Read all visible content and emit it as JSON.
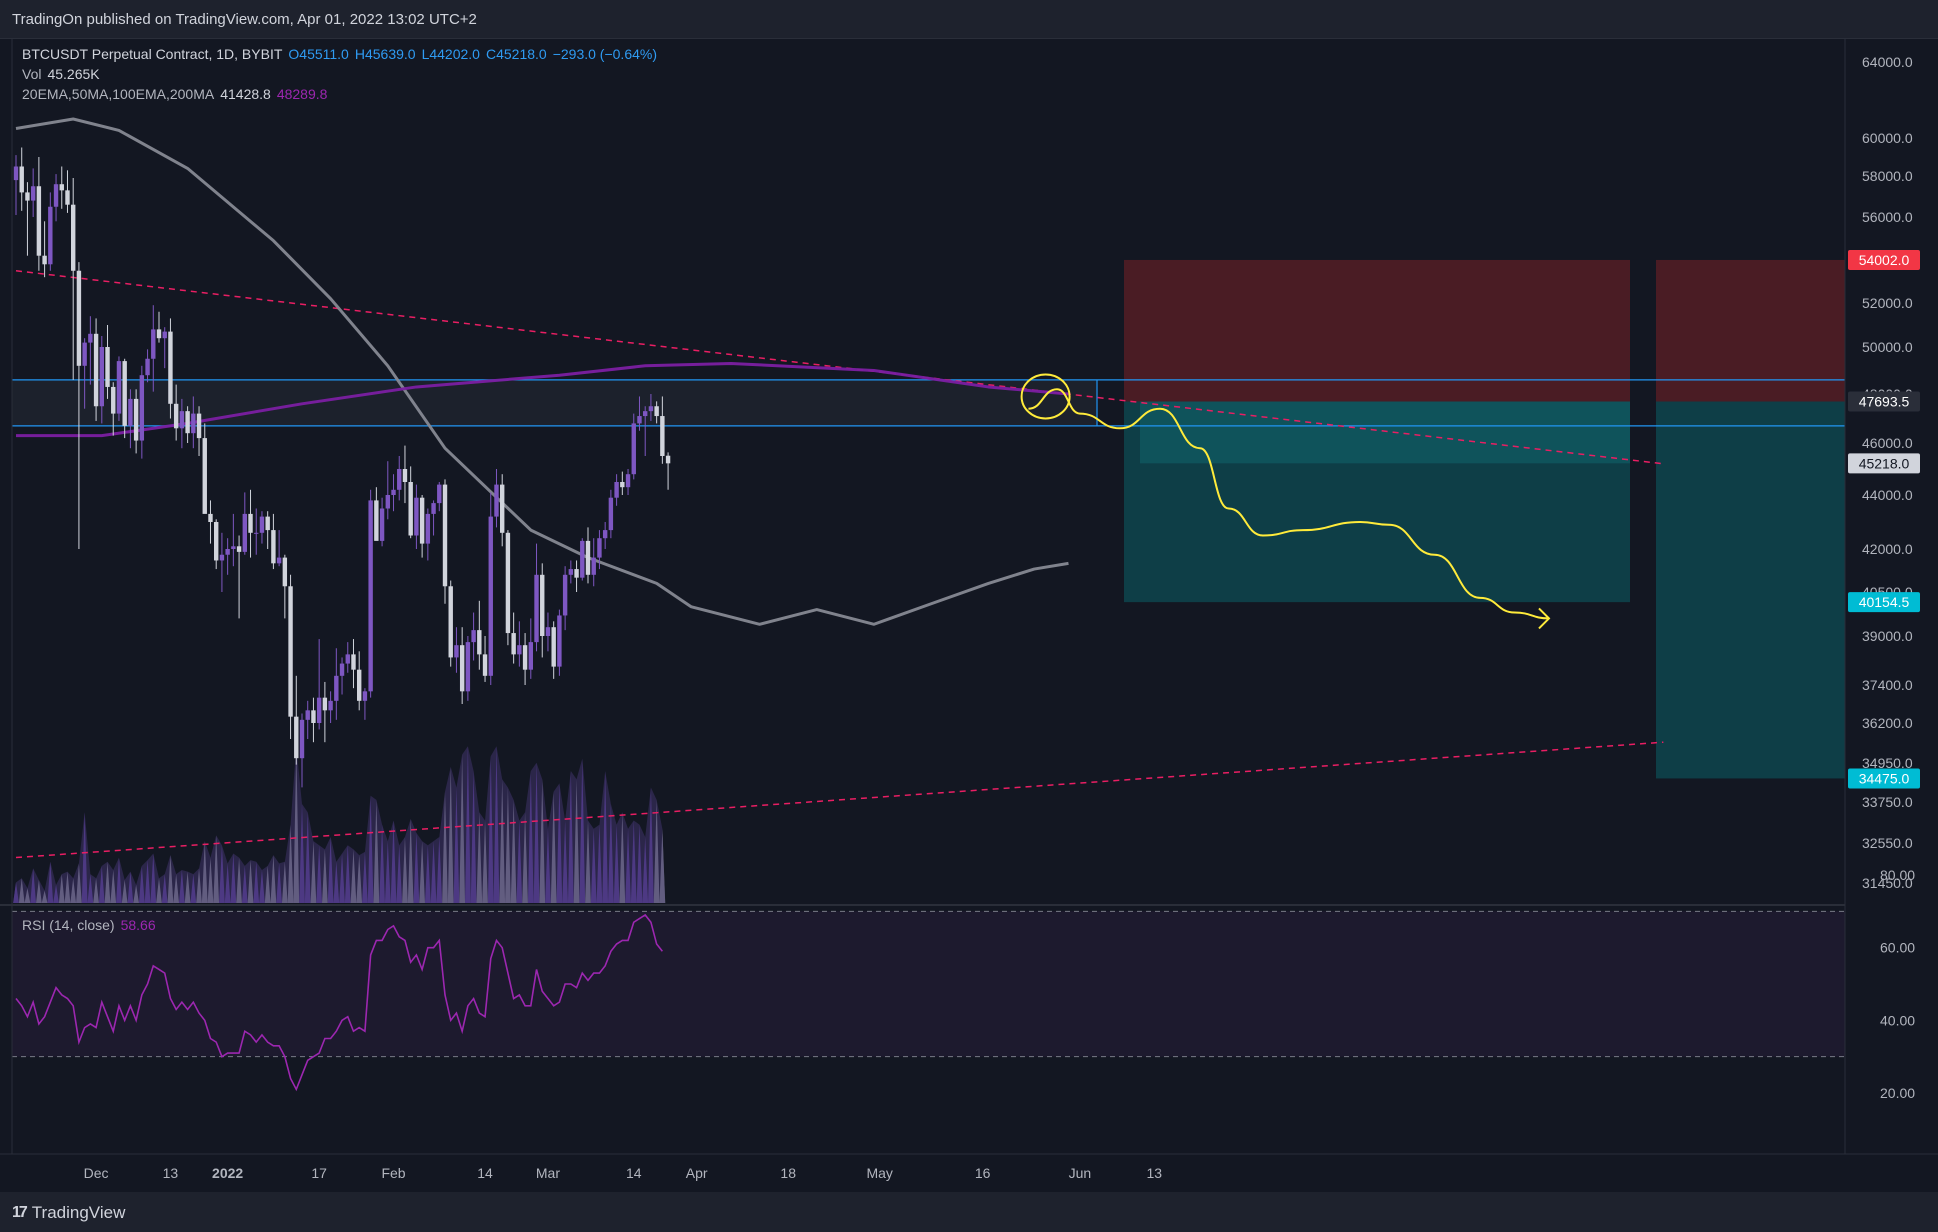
{
  "header": {
    "publisher_text": "TradingOn published on TradingView.com, Apr 01, 2022 13:02 UTC+2"
  },
  "footer": {
    "brand": "TradingView",
    "logo_glyph": "17"
  },
  "legend": {
    "symbol": "BTCUSDT Perpetual Contract, 1D, BYBIT",
    "open": "O45511.0",
    "high": "H45639.0",
    "low": "L44202.0",
    "close": "C45218.0",
    "change": "−293.0 (−0.64%)",
    "vol_label": "Vol",
    "vol_value": "45.265K",
    "ma_label": "20EMA,50MA,100EMA,200MA",
    "ma_value_1": "41428.8",
    "ma_value_2": "48289.8"
  },
  "rsi": {
    "label": "RSI (14, close)",
    "value": "58.66"
  },
  "colors": {
    "background": "#131722",
    "candle_up": "#7e57c2",
    "candle_down": "#d1d4dc",
    "ma_gray": "#868993",
    "ma_purple": "#7b1fa2",
    "trendline": "#e91e63",
    "horizontal_lines": "#2196f3",
    "projection": "#ffeb3b",
    "stop_zone": "#5d1f26",
    "target_zone": "#0e4851",
    "rsi_line": "#9c27b0"
  },
  "chart_data": {
    "type": "candlestick",
    "symbol": "BTCUSDT",
    "timeframe": "1D",
    "price_axis": {
      "ticks": [
        "64000.0",
        "60000.0",
        "58000.0",
        "56000.0",
        "52000.0",
        "50000.0",
        "48000.0",
        "46000.0",
        "44000.0",
        "42000.0",
        "40500.0",
        "39000.0",
        "37400.0",
        "36200.0",
        "34950.0",
        "33750.0",
        "32550.0",
        "31450.0"
      ],
      "labels": [
        {
          "text": "54002.0",
          "value": 54002,
          "color": "#f23645"
        },
        {
          "text": "47693.5",
          "value": 47693.5,
          "color": "#2a2e39"
        },
        {
          "text": "45218.0",
          "value": 45218,
          "color": "#d1d4dc"
        },
        {
          "text": "40154.5",
          "value": 40154.5,
          "color": "#00bcd4"
        },
        {
          "text": "34475.0",
          "value": 34475,
          "color": "#00bcd4"
        }
      ]
    },
    "time_axis": {
      "ticks": [
        "Dec",
        "13",
        "2022",
        "17",
        "Feb",
        "14",
        "Mar",
        "14",
        "Apr",
        "18",
        "May",
        "16",
        "Jun",
        "13"
      ]
    },
    "rsi_axis": {
      "ticks": [
        "80.00",
        "60.00",
        "40.00",
        "20.00"
      ],
      "overbought": 70,
      "oversold": 30
    },
    "candles": [
      [
        57800,
        59100,
        56100,
        58500
      ],
      [
        58500,
        59500,
        56300,
        57200
      ],
      [
        57200,
        57700,
        54200,
        56800
      ],
      [
        56800,
        58400,
        56000,
        57500
      ],
      [
        57500,
        59000,
        53500,
        54200
      ],
      [
        54200,
        55800,
        53200,
        53800
      ],
      [
        53800,
        57200,
        53500,
        56500
      ],
      [
        56500,
        58100,
        55800,
        57600
      ],
      [
        57600,
        58500,
        56400,
        57300
      ],
      [
        57300,
        58300,
        56200,
        56600
      ],
      [
        56600,
        57900,
        48600,
        53500
      ],
      [
        53500,
        53900,
        42000,
        49200
      ],
      [
        49200,
        50400,
        47400,
        50200
      ],
      [
        50200,
        51400,
        48400,
        50600
      ],
      [
        50600,
        51300,
        46900,
        47500
      ],
      [
        47500,
        50500,
        46800,
        50000
      ],
      [
        50000,
        51000,
        47800,
        48300
      ],
      [
        48300,
        48500,
        46300,
        47200
      ],
      [
        47200,
        49600,
        46900,
        49400
      ],
      [
        49400,
        49500,
        46200,
        46700
      ],
      [
        46700,
        48200,
        45800,
        47800
      ],
      [
        47800,
        48200,
        45600,
        46100
      ],
      [
        46100,
        49200,
        45400,
        48800
      ],
      [
        48800,
        49900,
        48500,
        49500
      ],
      [
        49500,
        51900,
        48100,
        50800
      ],
      [
        50800,
        51600,
        50200,
        50400
      ],
      [
        50400,
        50900,
        49100,
        50700
      ],
      [
        50700,
        51300,
        47000,
        47600
      ],
      [
        47600,
        48400,
        46100,
        46600
      ],
      [
        46600,
        47800,
        45800,
        47300
      ],
      [
        47300,
        47500,
        46000,
        46400
      ],
      [
        46400,
        47900,
        45800,
        47200
      ],
      [
        47200,
        47500,
        45500,
        46200
      ],
      [
        46200,
        46800,
        43800,
        43300
      ],
      [
        43300,
        43800,
        42200,
        43000
      ],
      [
        43000,
        43100,
        41300,
        41600
      ],
      [
        41600,
        42600,
        40500,
        41800
      ],
      [
        41800,
        42400,
        41100,
        42000
      ],
      [
        42000,
        43300,
        41400,
        42100
      ],
      [
        42100,
        42500,
        39600,
        41900
      ],
      [
        41900,
        44100,
        41800,
        43300
      ],
      [
        43300,
        44200,
        41700,
        42600
      ],
      [
        42600,
        43500,
        41800,
        42600
      ],
      [
        42600,
        43400,
        42200,
        43200
      ],
      [
        43200,
        43400,
        42000,
        42700
      ],
      [
        42700,
        43300,
        41300,
        41500
      ],
      [
        41500,
        42700,
        41400,
        41700
      ],
      [
        41700,
        41800,
        39600,
        40700
      ],
      [
        40700,
        41100,
        35700,
        36400
      ],
      [
        36400,
        37700,
        34900,
        35100
      ],
      [
        35100,
        36500,
        34200,
        36300
      ],
      [
        36300,
        36900,
        35700,
        36600
      ],
      [
        36600,
        37000,
        35600,
        36200
      ],
      [
        36200,
        38900,
        36000,
        37000
      ],
      [
        37000,
        37500,
        35600,
        36600
      ],
      [
        36600,
        37200,
        36200,
        36900
      ],
      [
        36900,
        38600,
        36300,
        37700
      ],
      [
        37700,
        38300,
        37100,
        38100
      ],
      [
        38100,
        38800,
        37800,
        38400
      ],
      [
        38400,
        38900,
        37300,
        37900
      ],
      [
        37900,
        38500,
        36600,
        36900
      ],
      [
        36900,
        37300,
        36300,
        37200
      ],
      [
        37200,
        44200,
        37000,
        43800
      ],
      [
        43800,
        44300,
        42700,
        42300
      ],
      [
        42300,
        43900,
        42100,
        43500
      ],
      [
        43500,
        45300,
        43100,
        44000
      ],
      [
        44000,
        44800,
        43400,
        44200
      ],
      [
        44200,
        45500,
        43800,
        45000
      ],
      [
        45000,
        45900,
        43700,
        44500
      ],
      [
        44500,
        45100,
        42400,
        42500
      ],
      [
        42500,
        44400,
        42000,
        43900
      ],
      [
        43900,
        44000,
        41700,
        42200
      ],
      [
        42200,
        43500,
        41600,
        43300
      ],
      [
        43300,
        43800,
        42500,
        43700
      ],
      [
        43700,
        44500,
        43400,
        44400
      ],
      [
        44400,
        44600,
        40100,
        40700
      ],
      [
        40700,
        40900,
        38000,
        38300
      ],
      [
        38300,
        39300,
        37800,
        38700
      ],
      [
        38700,
        39300,
        36800,
        37200
      ],
      [
        37200,
        39000,
        36900,
        38800
      ],
      [
        38800,
        39800,
        38200,
        39200
      ],
      [
        39200,
        40200,
        37900,
        38400
      ],
      [
        38400,
        39000,
        37500,
        37700
      ],
      [
        37700,
        44100,
        37400,
        43200
      ],
      [
        43200,
        45000,
        42800,
        44400
      ],
      [
        44400,
        44800,
        42100,
        42600
      ],
      [
        42600,
        42700,
        38700,
        39100
      ],
      [
        39100,
        39800,
        38100,
        38400
      ],
      [
        38400,
        39500,
        38000,
        38700
      ],
      [
        38700,
        39100,
        37400,
        37900
      ],
      [
        37900,
        39600,
        37600,
        38800
      ],
      [
        38800,
        42200,
        38500,
        41100
      ],
      [
        41100,
        41500,
        38300,
        39000
      ],
      [
        39000,
        39800,
        38500,
        39300
      ],
      [
        39300,
        39500,
        37600,
        38000
      ],
      [
        38000,
        39900,
        37700,
        39700
      ],
      [
        39700,
        41400,
        39200,
        41100
      ],
      [
        41100,
        41600,
        40800,
        41300
      ],
      [
        41300,
        41600,
        40500,
        41000
      ],
      [
        41000,
        42400,
        40900,
        42300
      ],
      [
        42300,
        42800,
        40800,
        41100
      ],
      [
        41100,
        42400,
        40700,
        41700
      ],
      [
        41700,
        42700,
        41300,
        42400
      ],
      [
        42400,
        43000,
        42000,
        42700
      ],
      [
        42700,
        44200,
        42400,
        43900
      ],
      [
        43900,
        44800,
        43600,
        44500
      ],
      [
        44500,
        44900,
        44000,
        44300
      ],
      [
        44300,
        45000,
        44000,
        44800
      ],
      [
        44800,
        47200,
        44600,
        46800
      ],
      [
        46800,
        47900,
        46500,
        47100
      ],
      [
        47100,
        47500,
        45500,
        47300
      ],
      [
        47300,
        48000,
        46900,
        47500
      ],
      [
        47500,
        47700,
        46800,
        47100
      ],
      [
        47100,
        47900,
        45200,
        45500
      ],
      [
        45511,
        45639,
        44202,
        45218
      ]
    ],
    "rsi_values": [
      46,
      44,
      41,
      45,
      39,
      41,
      45,
      49,
      47,
      46,
      44,
      34,
      38,
      39,
      38,
      45,
      41,
      37,
      44,
      40,
      44,
      40,
      47,
      50,
      55,
      54,
      53,
      46,
      43,
      45,
      43,
      45,
      42,
      40,
      35,
      34,
      30,
      31,
      31,
      31,
      37,
      36,
      34,
      36,
      34,
      33,
      33,
      30,
      24,
      21,
      25,
      29,
      30,
      31,
      35,
      35,
      37,
      40,
      41,
      37,
      38,
      37,
      58,
      62,
      62,
      65,
      66,
      63,
      62,
      56,
      58,
      54,
      60,
      60,
      62,
      47,
      40,
      42,
      37,
      44,
      46,
      42,
      41,
      57,
      62,
      60,
      53,
      46,
      47,
      44,
      44,
      54,
      48,
      46,
      44,
      45,
      50,
      50,
      49,
      53,
      51,
      53,
      53,
      55,
      59,
      61,
      62,
      62,
      67,
      68,
      69,
      67,
      61,
      59
    ],
    "volume_values": [
      25,
      30,
      18,
      42,
      28,
      15,
      50,
      22,
      35,
      38,
      30,
      48,
      110,
      35,
      30,
      45,
      50,
      40,
      55,
      28,
      38,
      22,
      45,
      52,
      60,
      30,
      35,
      58,
      35,
      40,
      38,
      35,
      42,
      75,
      55,
      82,
      70,
      48,
      60,
      55,
      45,
      52,
      50,
      40,
      45,
      58,
      48,
      50,
      95,
      190,
      120,
      110,
      75,
      70,
      65,
      80,
      50,
      60,
      70,
      65,
      58,
      62,
      130,
      125,
      95,
      75,
      100,
      70,
      80,
      102,
      85,
      75,
      70,
      75,
      80,
      135,
      165,
      140,
      180,
      190,
      160,
      110,
      100,
      178,
      190,
      150,
      140,
      125,
      100,
      110,
      160,
      170,
      150,
      90,
      135,
      145,
      100,
      160,
      150,
      175,
      100,
      90,
      95,
      160,
      120,
      95,
      110,
      90,
      100,
      95,
      80,
      140,
      125,
      90
    ],
    "moving_averages": [
      {
        "name": "50MA",
        "color": "#868993",
        "points": [
          [
            0,
            60500
          ],
          [
            10,
            61000
          ],
          [
            18,
            60400
          ],
          [
            30,
            58400
          ],
          [
            45,
            54900
          ],
          [
            55,
            52200
          ],
          [
            65,
            49200
          ],
          [
            75,
            45800
          ],
          [
            90,
            42700
          ],
          [
            100,
            41700
          ],
          [
            112,
            40800
          ],
          [
            118,
            40000
          ],
          [
            130,
            39400
          ],
          [
            140,
            39900
          ],
          [
            150,
            39400
          ],
          [
            160,
            40100
          ],
          [
            170,
            40800
          ],
          [
            178,
            41300
          ],
          [
            184,
            41500
          ]
        ]
      },
      {
        "name": "200MA",
        "color": "#7b1fa2",
        "points": [
          [
            0,
            46300
          ],
          [
            15,
            46300
          ],
          [
            30,
            46800
          ],
          [
            50,
            47600
          ],
          [
            70,
            48300
          ],
          [
            95,
            48800
          ],
          [
            110,
            49200
          ],
          [
            125,
            49300
          ],
          [
            150,
            49000
          ],
          [
            170,
            48300
          ],
          [
            184,
            48000
          ]
        ]
      }
    ],
    "drawings": {
      "horizontal_lines": [
        48600,
        46700
      ],
      "upper_trendline": [
        [
          0,
          53500
        ],
        [
          288,
          45200
        ]
      ],
      "lower_trendline": [
        [
          0,
          32150
        ],
        [
          288,
          35600
        ]
      ],
      "short_position_1": {
        "entry": 47693.5,
        "stop": 54002,
        "target": 40154.5
      },
      "short_position_2": {
        "entry": 47693.5,
        "stop": 54002,
        "target": 34475
      },
      "projection_points": [
        [
          177,
          47400
        ],
        [
          182,
          48200
        ],
        [
          186,
          47200
        ],
        [
          193,
          46600
        ],
        [
          200,
          47400
        ],
        [
          207,
          45800
        ],
        [
          212,
          43500
        ],
        [
          218,
          42500
        ],
        [
          225,
          42700
        ],
        [
          235,
          43000
        ],
        [
          240,
          42900
        ],
        [
          248,
          41800
        ],
        [
          256,
          40300
        ],
        [
          262,
          39800
        ],
        [
          268,
          39600
        ]
      ]
    }
  }
}
